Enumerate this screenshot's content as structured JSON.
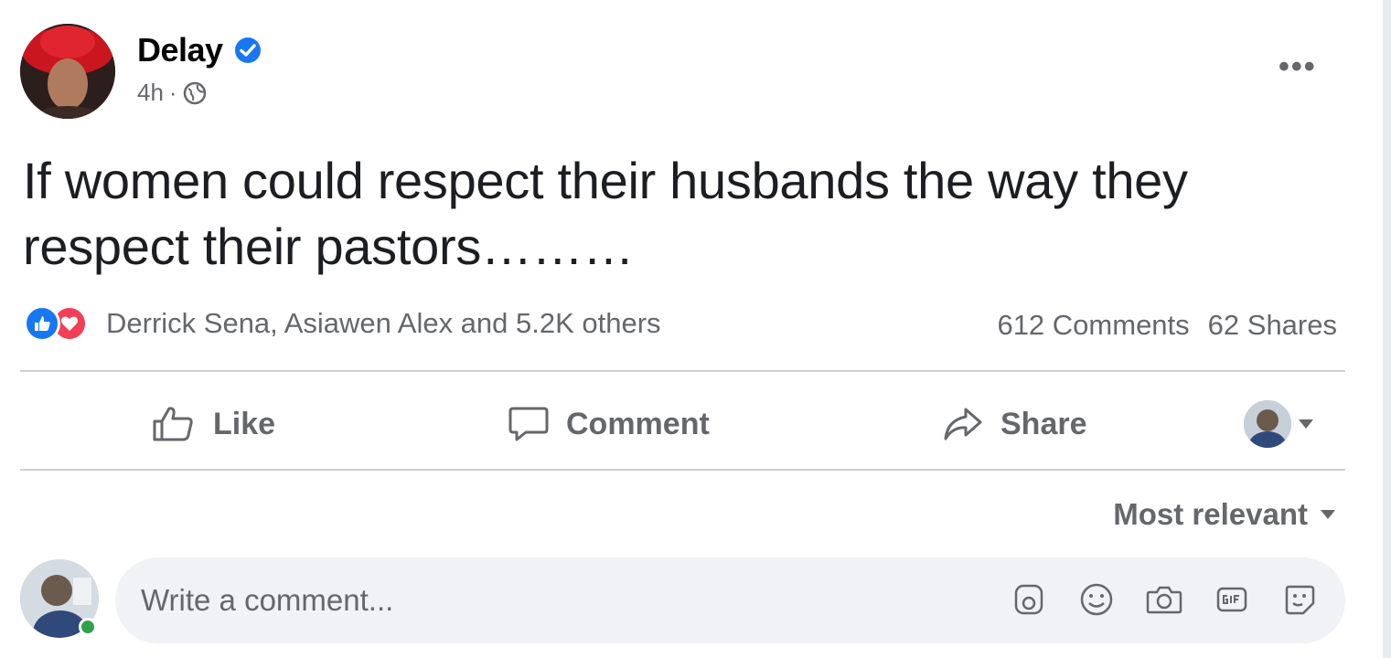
{
  "post": {
    "author": "Delay",
    "time": "4h",
    "separator": "·",
    "text": "If women could respect their husbands the way they respect their pastors………",
    "reactions_text": "Derrick Sena, Asiawen Alex and 5.2K others",
    "comments_count": "612 Comments",
    "shares_count": "62 Shares"
  },
  "actions": {
    "like": "Like",
    "comment": "Comment",
    "share": "Share"
  },
  "comments": {
    "sort_label": "Most relevant",
    "composer_placeholder": "Write a comment..."
  },
  "colors": {
    "verified": "#1877f2",
    "like_reaction": "#1877f2",
    "love_reaction": "#f33e58",
    "online": "#31a24c",
    "secondary_text": "#65676b"
  },
  "icons": [
    "verified-badge-icon",
    "globe-icon",
    "more-options-icon",
    "like-reaction-icon",
    "love-reaction-icon",
    "thumbs-up-icon",
    "comment-bubble-icon",
    "share-arrow-icon",
    "caret-down-icon",
    "avatar-sticker-icon",
    "emoji-icon",
    "camera-icon",
    "gif-icon",
    "sticker-icon"
  ]
}
